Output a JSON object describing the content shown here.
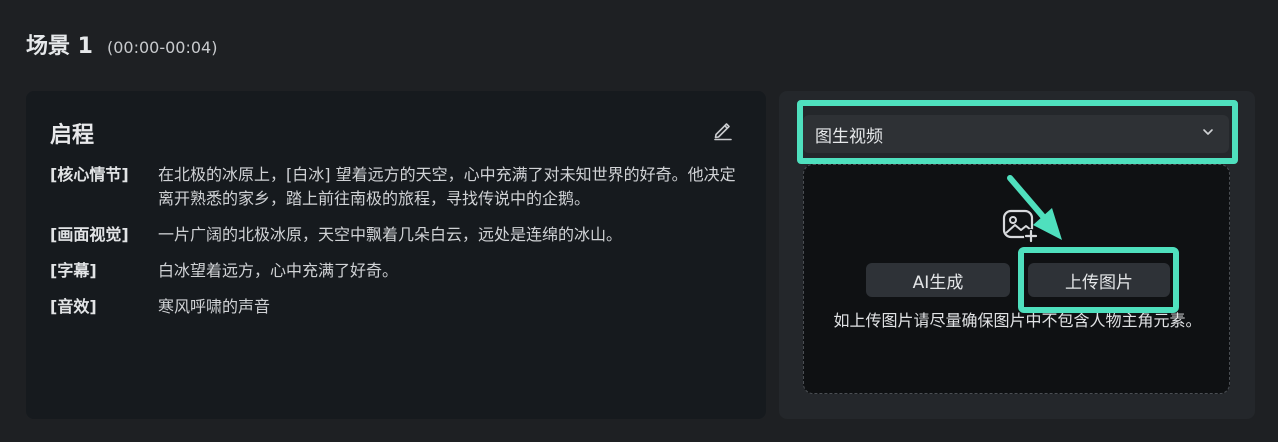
{
  "scene": {
    "title": "场景 1",
    "time_range": "(00:00-00:04)"
  },
  "story": {
    "title": "启程",
    "rows": [
      {
        "label": "[核心情节]",
        "text": "在北极的冰原上，[白冰] 望着远方的天空，心中充满了对未知世界的好奇。他决定离开熟悉的家乡，踏上前往南极的旅程，寻找传说中的企鹅。"
      },
      {
        "label": "[画面视觉]",
        "text": "一片广阔的北极冰原，天空中飘着几朵白云，远处是连绵的冰山。"
      },
      {
        "label": "[字幕]",
        "text": "白冰望着远方，心中充满了好奇。"
      },
      {
        "label": "[音效]",
        "text": "寒风呼啸的声音"
      }
    ],
    "edit_icon": "pencil-icon"
  },
  "generator": {
    "mode_selected": "图生视频",
    "dropdown_icon": "chevron-down-icon",
    "upload_area_icon": "image-add-icon",
    "ai_button_label": "AI生成",
    "upload_button_label": "上传图片",
    "hint": "如上传图片请尽量确保图片中不包含人物主角元素。"
  },
  "colors": {
    "highlight": "#4fe0be",
    "background": "#1e2023",
    "left_panel": "#161a1e",
    "right_panel": "#24272b"
  }
}
